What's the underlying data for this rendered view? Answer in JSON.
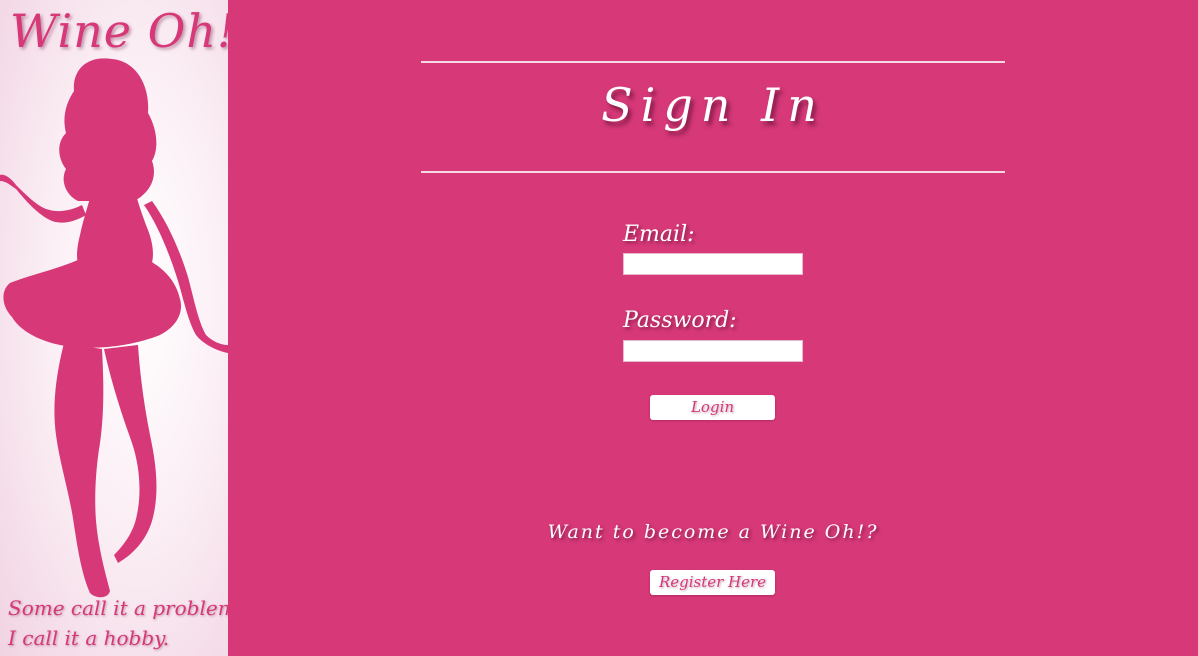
{
  "colors": {
    "page_background": "#d63878",
    "sidebar_background": "#fbeff5",
    "brand_pink": "#d63878",
    "text_white": "#ffffff"
  },
  "sidebar": {
    "brand": "Wine Oh!",
    "silhouette_icon": "woman-silhouette-icon",
    "tagline_line1": "Some call it a problem,",
    "tagline_line2": "I call it a hobby."
  },
  "main": {
    "title": "Sign In",
    "email": {
      "label": "Email:",
      "value": "",
      "placeholder": ""
    },
    "password": {
      "label": "Password:",
      "value": "",
      "placeholder": ""
    },
    "login_button": "Login",
    "register_prompt": "Want to become a Wine Oh!?",
    "register_button": "Register Here"
  }
}
